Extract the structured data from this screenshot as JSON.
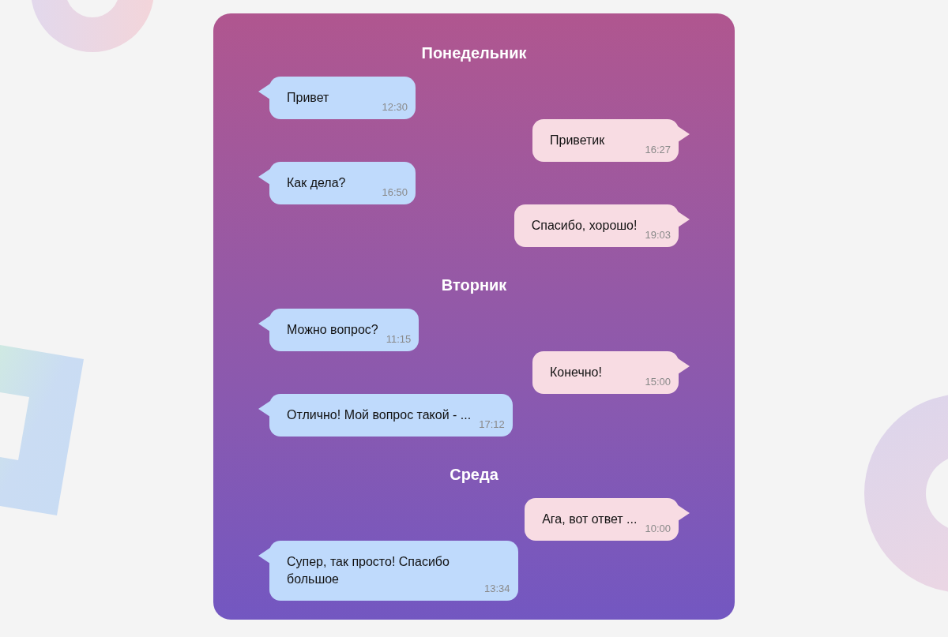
{
  "days": [
    {
      "title": "Понедельник",
      "messages": [
        {
          "kind": "received",
          "text": "Привет",
          "time": "12:30"
        },
        {
          "kind": "sent",
          "text": "Приветик",
          "time": "16:27"
        },
        {
          "kind": "received",
          "text": "Как дела?",
          "time": "16:50"
        },
        {
          "kind": "sent",
          "text": "Спасибо, хорошо!",
          "time": "19:03"
        }
      ]
    },
    {
      "title": "Вторник",
      "messages": [
        {
          "kind": "received",
          "text": "Можно вопрос?",
          "time": "11:15"
        },
        {
          "kind": "sent",
          "text": "Конечно!",
          "time": "15:00"
        },
        {
          "kind": "received",
          "text": "Отлично! Мой вопрос такой - ...",
          "time": "17:12"
        }
      ]
    },
    {
      "title": "Среда",
      "messages": [
        {
          "kind": "sent",
          "text": "Ага, вот ответ ...",
          "time": "10:00"
        },
        {
          "kind": "received",
          "text": "Супер, так просто! Спасибо большое",
          "time": "13:34"
        }
      ]
    }
  ]
}
